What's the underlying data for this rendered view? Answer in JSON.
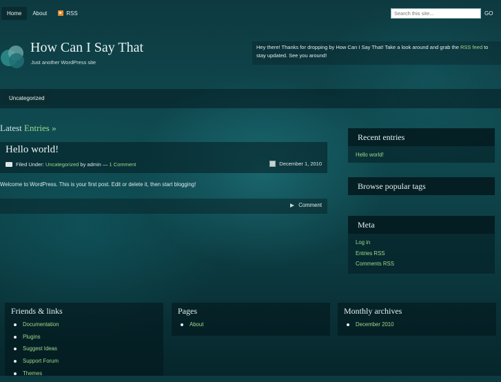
{
  "nav": {
    "home": "Home",
    "about": "About",
    "rss": "RSS"
  },
  "search": {
    "placeholder": "Search this site...",
    "go": "GO"
  },
  "site": {
    "title": "How Can I Say That",
    "tagline": "Just another WordPress site"
  },
  "welcome": {
    "text_before": "Hey there! Thanks for dropping by How Can I Say That! Take a look around and grab the ",
    "link": "RSS feed",
    "text_after": " to stay updated. See you around!"
  },
  "categories": [
    "Uncategorized"
  ],
  "main": {
    "latest_prefix": "Latest",
    "latest_highlight": "Entries »",
    "post": {
      "title": "Hello world!",
      "filed_under": "Filed Under:",
      "category": "Uncategorized",
      "by": "by admin —",
      "comments_link": "1 Comment",
      "date": "December 1, 2010",
      "body": "Welcome to WordPress. This is your first post. Edit or delete it, then start blogging!",
      "comment_label": "Comment"
    }
  },
  "sidebar": {
    "recent": {
      "title": "Recent entries",
      "items": [
        "Hello world!"
      ]
    },
    "tags": {
      "title": "Browse popular tags"
    },
    "meta": {
      "title": "Meta",
      "items": [
        "Log in",
        "Entries RSS",
        "Comments RSS"
      ]
    }
  },
  "footer": {
    "friends": {
      "title": "Friends & links",
      "items": [
        "Documentation",
        "Plugins",
        "Suggest Ideas",
        "Support Forum",
        "Themes"
      ]
    },
    "pages": {
      "title": "Pages",
      "items": [
        "About"
      ]
    },
    "archives": {
      "title": "Monthly archives",
      "items": [
        "December 2010"
      ]
    }
  },
  "colors": {
    "link": "#9fd88a",
    "rss_icon": "#e58b2d",
    "panel": "#0a2c31"
  }
}
